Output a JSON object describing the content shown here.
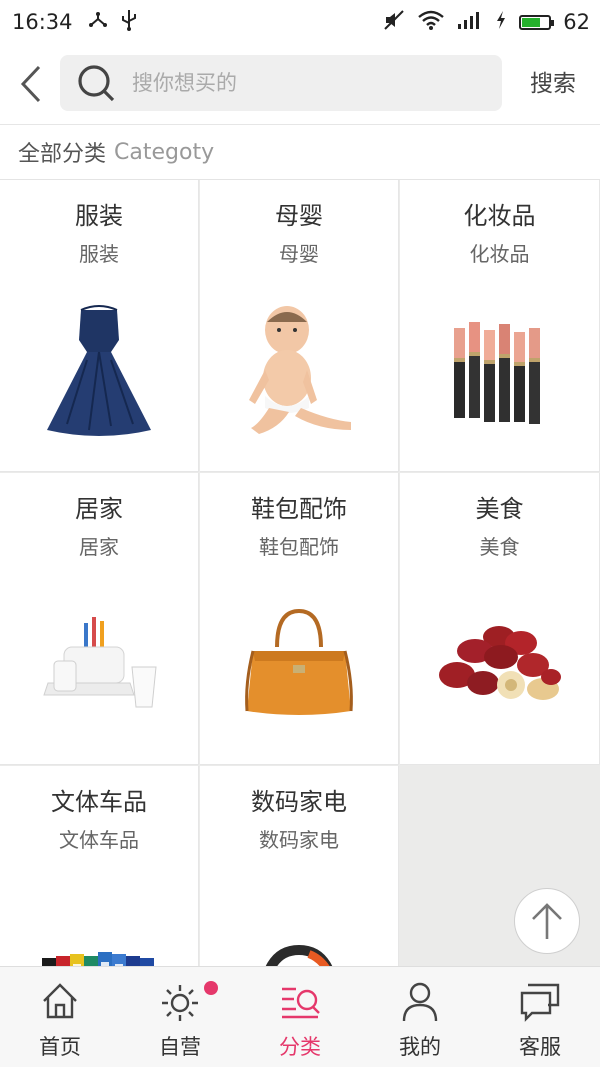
{
  "status_bar": {
    "time": "16:34",
    "battery": "62",
    "battery_color": "#25b02c"
  },
  "header": {
    "search_placeholder": "搜你想买的",
    "search_button": "搜索"
  },
  "category": {
    "title_cn": "全部分类",
    "title_en": "Categoty"
  },
  "grid": [
    {
      "title": "服装",
      "subtitle": "服装",
      "icon": "dress-image"
    },
    {
      "title": "母婴",
      "subtitle": "母婴",
      "icon": "baby-image"
    },
    {
      "title": "化妆品",
      "subtitle": "化妆品",
      "icon": "lipstick-image"
    },
    {
      "title": "居家",
      "subtitle": "居家",
      "icon": "toothbrush-holder-image"
    },
    {
      "title": "鞋包配饰",
      "subtitle": "鞋包配饰",
      "icon": "handbag-image"
    },
    {
      "title": "美食",
      "subtitle": "美食",
      "icon": "red-dates-image"
    },
    {
      "title": "文体车品",
      "subtitle": "文体车品",
      "icon": "binders-image"
    },
    {
      "title": "数码家电",
      "subtitle": "数码家电",
      "icon": "headphones-image"
    }
  ],
  "bottom_nav": [
    {
      "label": "首页",
      "icon": "home-icon"
    },
    {
      "label": "自营",
      "icon": "sun-icon"
    },
    {
      "label": "分类",
      "icon": "category-icon",
      "active": true
    },
    {
      "label": "我的",
      "icon": "user-icon"
    },
    {
      "label": "客服",
      "icon": "chat-icon"
    }
  ],
  "colors": {
    "accent": "#e5386b",
    "grid_background": "#ebebea",
    "search_background": "#efefef"
  }
}
